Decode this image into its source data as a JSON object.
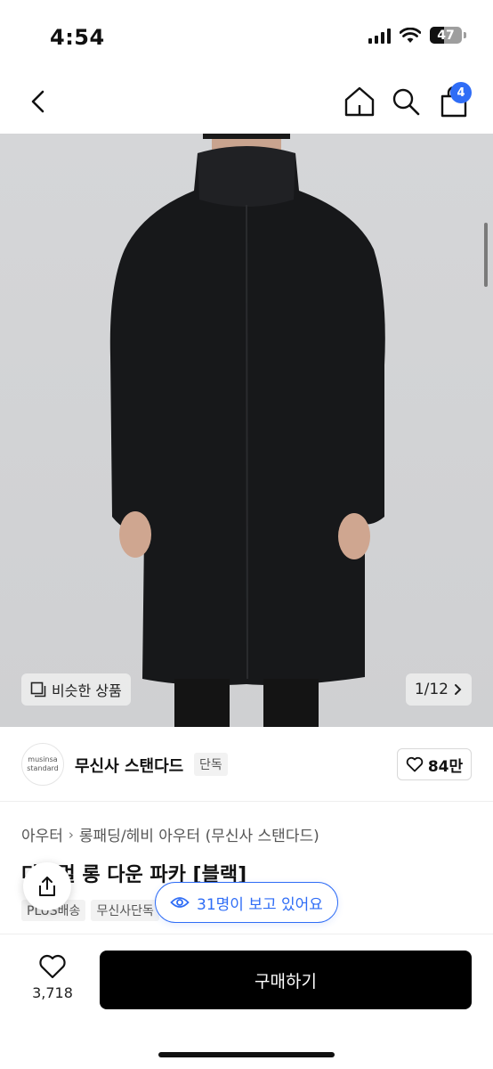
{
  "status_bar": {
    "time": "4:54",
    "battery": "47"
  },
  "nav": {
    "cart_count": "4"
  },
  "colors": {
    "accent": "#2f6df6",
    "buy_button": "#000000",
    "image_bg": "#d2d3d5"
  },
  "gallery": {
    "similar_label": "비슷한 상품",
    "counter": "1/12"
  },
  "brand": {
    "logo_line1": "musinsa",
    "logo_line2": "standard",
    "name": "무신사 스탠다드",
    "tag": "단독",
    "likes": "84만"
  },
  "breadcrumb": {
    "items": [
      "아우터",
      "롱패딩/헤비 아우터 (무신사 스탠다드)"
    ]
  },
  "product": {
    "title": "다크멀 롱 다운 파카 [블랙]",
    "tags": [
      "PLUS배송",
      "무신사단독"
    ]
  },
  "viewers": {
    "text": "31명이 보고 있어요"
  },
  "bottom": {
    "wish_count": "3,718",
    "buy_label": "구매하기"
  }
}
